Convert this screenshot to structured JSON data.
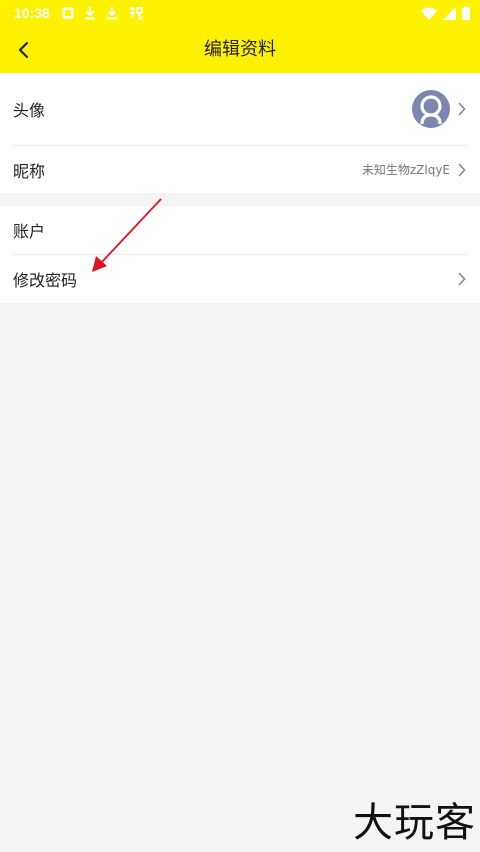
{
  "status_bar": {
    "time": "10:38",
    "icons_left": [
      "gallery-notification-icon",
      "download-icon",
      "download-icon",
      "app-notification-icon"
    ],
    "icons_right": [
      "wifi-icon",
      "signal-icon",
      "battery-icon"
    ]
  },
  "header": {
    "title": "编辑资料",
    "background": "#fff200"
  },
  "profile": {
    "avatar_label": "头像",
    "nickname_label": "昵称",
    "nickname_value": "未知生物zZlqyE"
  },
  "account": {
    "account_label": "账户",
    "change_password_label": "修改密码"
  },
  "annotation": {
    "color": "#e0141e"
  },
  "watermark": {
    "text": "大玩客"
  }
}
